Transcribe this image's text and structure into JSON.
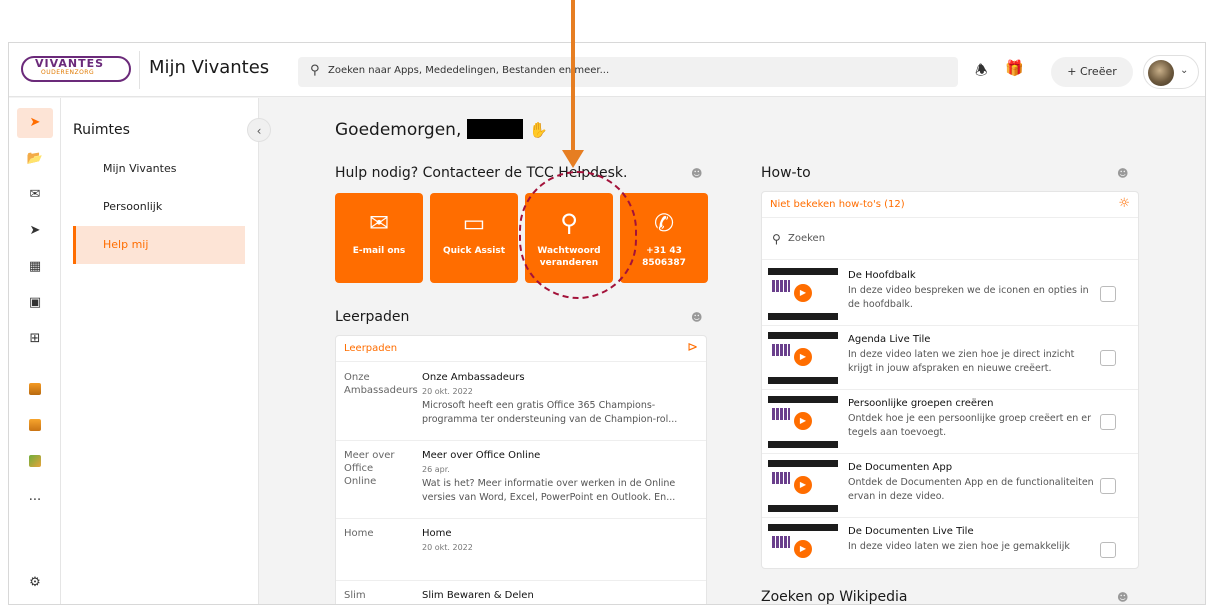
{
  "header": {
    "logo_text": "VIVANTES",
    "logo_subtext": "OUDERENZORG",
    "app_title": "Mijn Vivantes",
    "search_placeholder": "Zoeken naar Apps, Mededelingen, Bestanden en meer...",
    "create_label": "+ Creëer"
  },
  "sidebar": {
    "title": "Ruimtes",
    "items": [
      {
        "label": "Mijn Vivantes"
      },
      {
        "label": "Persoonlijk"
      },
      {
        "label": "Help mij"
      }
    ],
    "active_index": 2
  },
  "rail": {
    "icons": [
      "rocket-icon",
      "folder-icon",
      "mail-icon",
      "send-icon",
      "contact-card-icon",
      "calendar-icon",
      "apps-grid-icon",
      "app-tile-1-icon",
      "app-tile-2-icon",
      "app-tile-3-icon",
      "more-icon",
      "settings-icon"
    ],
    "more_label": "..."
  },
  "greeting": {
    "text": "Goedemorgen,"
  },
  "help": {
    "title": "Hulp nodig? Contacteer de TCC Helpdesk.",
    "buttons": [
      {
        "label": "E-mail ons",
        "icon": "envelope-icon"
      },
      {
        "label": "Quick Assist",
        "icon": "monitor-icon"
      },
      {
        "label": "Wachtwoord veranderen",
        "icon": "key-icon"
      },
      {
        "label": "+31 43 8506387",
        "icon": "phone-icon"
      }
    ]
  },
  "learning": {
    "title": "Leerpaden",
    "card_label": "Leerpaden",
    "items": [
      {
        "img_alt": "Onze Ambassadeurs",
        "title": "Onze Ambassadeurs",
        "date": "20 okt. 2022",
        "desc": "Microsoft heeft een gratis Office 365 Champions-programma ter ondersteuning van de Champion-rol..."
      },
      {
        "img_alt": "Meer over Office Online",
        "title": "Meer over Office Online",
        "date": "26 apr.",
        "desc": "Wat is het? Meer informatie over werken in de Online versies van Word, Excel, PowerPoint en Outlook. En..."
      },
      {
        "img_alt": "Home",
        "title": "Home",
        "date": "20 okt. 2022",
        "desc": ""
      },
      {
        "img_alt": "Slim",
        "title": "Slim Bewaren & Delen",
        "date": "",
        "desc": ""
      }
    ]
  },
  "howto": {
    "title": "How-to",
    "filter_label": "Niet bekeken how-to's (12)",
    "search_placeholder": "Zoeken",
    "items": [
      {
        "title": "De Hoofdbalk",
        "desc": "In deze video bespreken we de iconen en opties in de hoofdbalk."
      },
      {
        "title": "Agenda Live Tile",
        "desc": "In deze video laten we zien hoe je direct inzicht krijgt in jouw afspraken en nieuwe creëert."
      },
      {
        "title": "Persoonlijke groepen creëren",
        "desc": "Ontdek hoe je een persoonlijke groep creëert en er tegels aan toevoegt."
      },
      {
        "title": "De Documenten App",
        "desc": "Ontdek de Documenten App en de functionaliteiten ervan in deze video."
      },
      {
        "title": "De Documenten Live Tile",
        "desc": "In deze video laten we zien hoe je gemakkelijk"
      }
    ]
  },
  "wikipedia": {
    "title": "Zoeken op Wikipedia"
  },
  "colors": {
    "accent": "#ff6d00",
    "active_bg": "#fde4d6",
    "annotation_arrow": "#e67e22",
    "annotation_circle": "#a3123a"
  }
}
